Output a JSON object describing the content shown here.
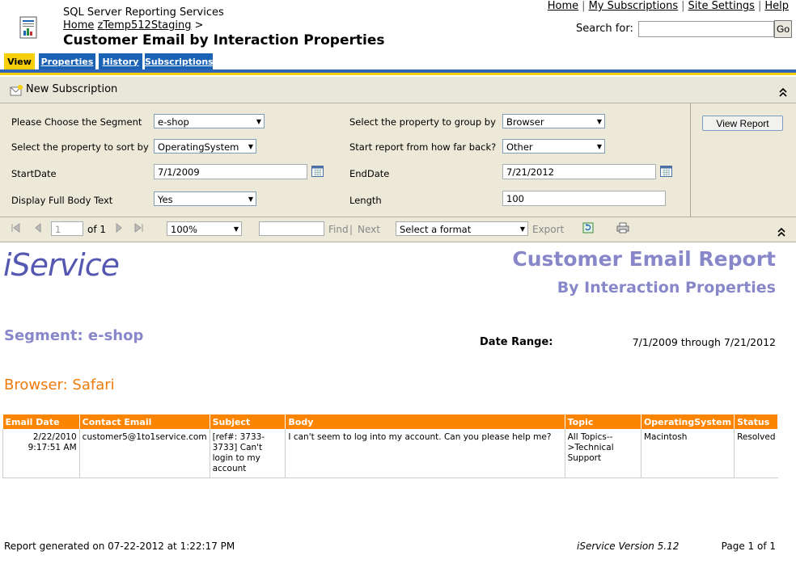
{
  "header": {
    "app_name": "SQL Server Reporting Services",
    "breadcrumb": {
      "home": "Home",
      "folder": "zTemp512Staging",
      "sep": ">"
    },
    "title": "Customer Email by Interaction Properties",
    "links": {
      "home": "Home",
      "subscriptions": "My Subscriptions",
      "site_settings": "Site Settings",
      "help": "Help"
    },
    "search_label": "Search for:",
    "search_value": "",
    "go_label": "Go"
  },
  "tabs": [
    {
      "label": "View"
    },
    {
      "label": "Properties"
    },
    {
      "label": "History"
    },
    {
      "label": "Subscriptions"
    }
  ],
  "subscription_bar": {
    "label": "New Subscription"
  },
  "params": {
    "segment": {
      "label": "Please Choose the Segment",
      "value": "e-shop"
    },
    "group_by": {
      "label": "Select the property to group by",
      "value": "Browser"
    },
    "sort_by": {
      "label": "Select the property to sort by",
      "value": "OperatingSystem"
    },
    "how_far_back": {
      "label": "Start report from how far back?",
      "value": "Other"
    },
    "start_date": {
      "label": "StartDate",
      "value": "7/1/2009"
    },
    "end_date": {
      "label": "EndDate",
      "value": "7/21/2012"
    },
    "full_body": {
      "label": "Display Full Body Text",
      "value": "Yes"
    },
    "length": {
      "label": "Length",
      "value": "100"
    },
    "view_report_label": "View Report"
  },
  "toolbar": {
    "page_value": "1",
    "of_label": "of 1",
    "zoom_value": "100%",
    "find_label": "Find",
    "sep": "|",
    "next_label": "Next",
    "format_value": "Select a format",
    "export_label": "Export"
  },
  "report": {
    "logo_text": "iService",
    "title": "Customer Email Report",
    "subtitle": "By Interaction Properties",
    "segment": "Segment: e-shop",
    "date_range_label": "Date Range:",
    "date_range_value": "7/1/2009 through 7/21/2012",
    "group_heading": "Browser: Safari",
    "columns": [
      "Email Date",
      "Contact Email",
      "Subject",
      "Body",
      "Topic",
      "OperatingSystem",
      "Status"
    ],
    "rows": [
      {
        "date": "2/22/2010",
        "time": "9:17:51 AM",
        "contact": "customer5@1to1service.com",
        "subject": "[ref#: 3733-3733] Can't login to my account",
        "body": "I can't seem to log into my account. Can you please help me?",
        "topic": "All Topics-->Technical Support",
        "os": "Macintosh",
        "status": "Resolved"
      }
    ],
    "footer_generated": "Report generated on 07-22-2012 at 1:22:17 PM",
    "footer_version": "iService Version 5.12",
    "footer_page": "Page 1 of 1"
  }
}
